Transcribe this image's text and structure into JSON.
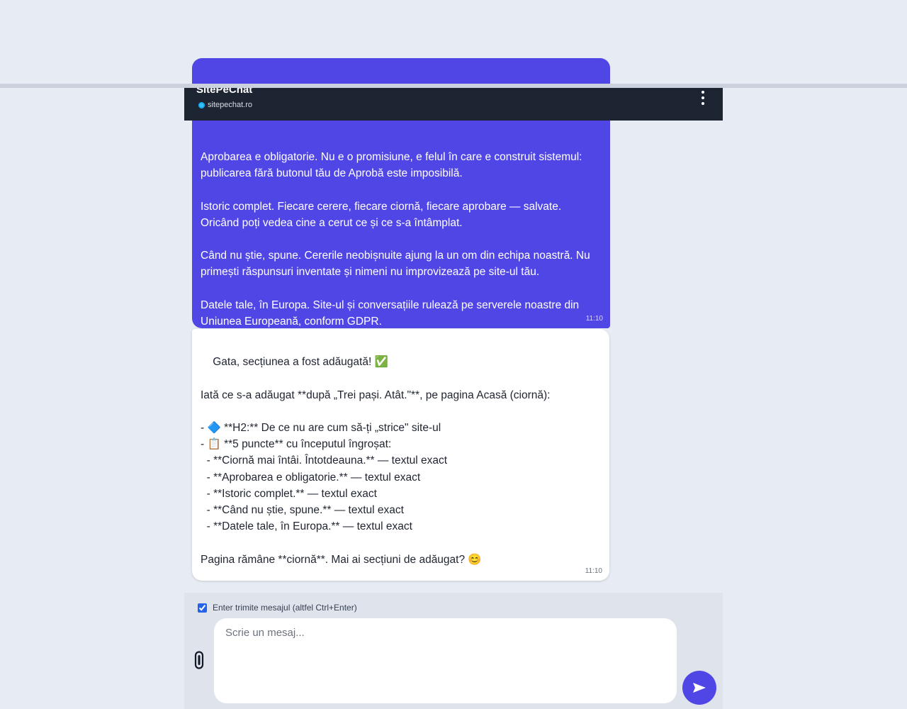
{
  "header": {
    "title": "SitePeChat",
    "domain": "sitepechat.ro"
  },
  "messages": {
    "user": {
      "text": "Folosește textul EXACT cum ți-l dau, fără să reformulezi și fără să adaugi de la\n\n\n\nAprobarea e obligatorie. Nu e o promisiune, e felul în care e construit sistemul: publicarea fără butonul tău de Aprobă este imposibilă.\n\nIstoric complet. Fiecare cerere, fiecare ciornă, fiecare aprobare — salvate. Oricând poți vedea cine a cerut ce și ce s-a întâmplat.\n\nCând nu știe, spune. Cererile neobișnuite ajung la un om din echipa noastră. Nu primești răspunsuri inventate și nimeni nu improvizează pe site-ul tău.\n\nDatele tale, în Europa. Site-ul și conversațiile rulează pe serverele noastre din Uniunea Europeană, conform GDPR.",
      "time": "11:10"
    },
    "bot": {
      "text": "Gata, secțiunea a fost adăugată! ✅\n\nIată ce s-a adăugat **după „Trei pași. Atât.\"**, pe pagina Acasă (ciornă):\n\n- 🔷 **H2:** De ce nu are cum să-ți „strice\" site-ul\n- 📋 **5 puncte** cu începutul îngroșat:\n  - **Ciornă mai întâi. Întotdeauna.** — textul exact\n  - **Aprobarea e obligatorie.** — textul exact\n  - **Istoric complet.** — textul exact\n  - **Când nu știe, spune.** — textul exact\n  - **Datele tale, în Europa.** — textul exact\n\nPagina rămâne **ciornă**. Mai ai secțiuni de adăugat? 😊",
      "time": "11:10"
    }
  },
  "composer": {
    "enter_label": "Enter trimite mesajul (altfel Ctrl+Enter)",
    "enter_checked": true,
    "placeholder": "Scrie un mesaj..."
  },
  "colors": {
    "accent": "#5046e5",
    "header_bg": "#1e2532",
    "page_bg": "#e7ebf3"
  },
  "icons": [
    "globe-icon",
    "more-vertical-icon",
    "paperclip-icon",
    "send-icon"
  ]
}
